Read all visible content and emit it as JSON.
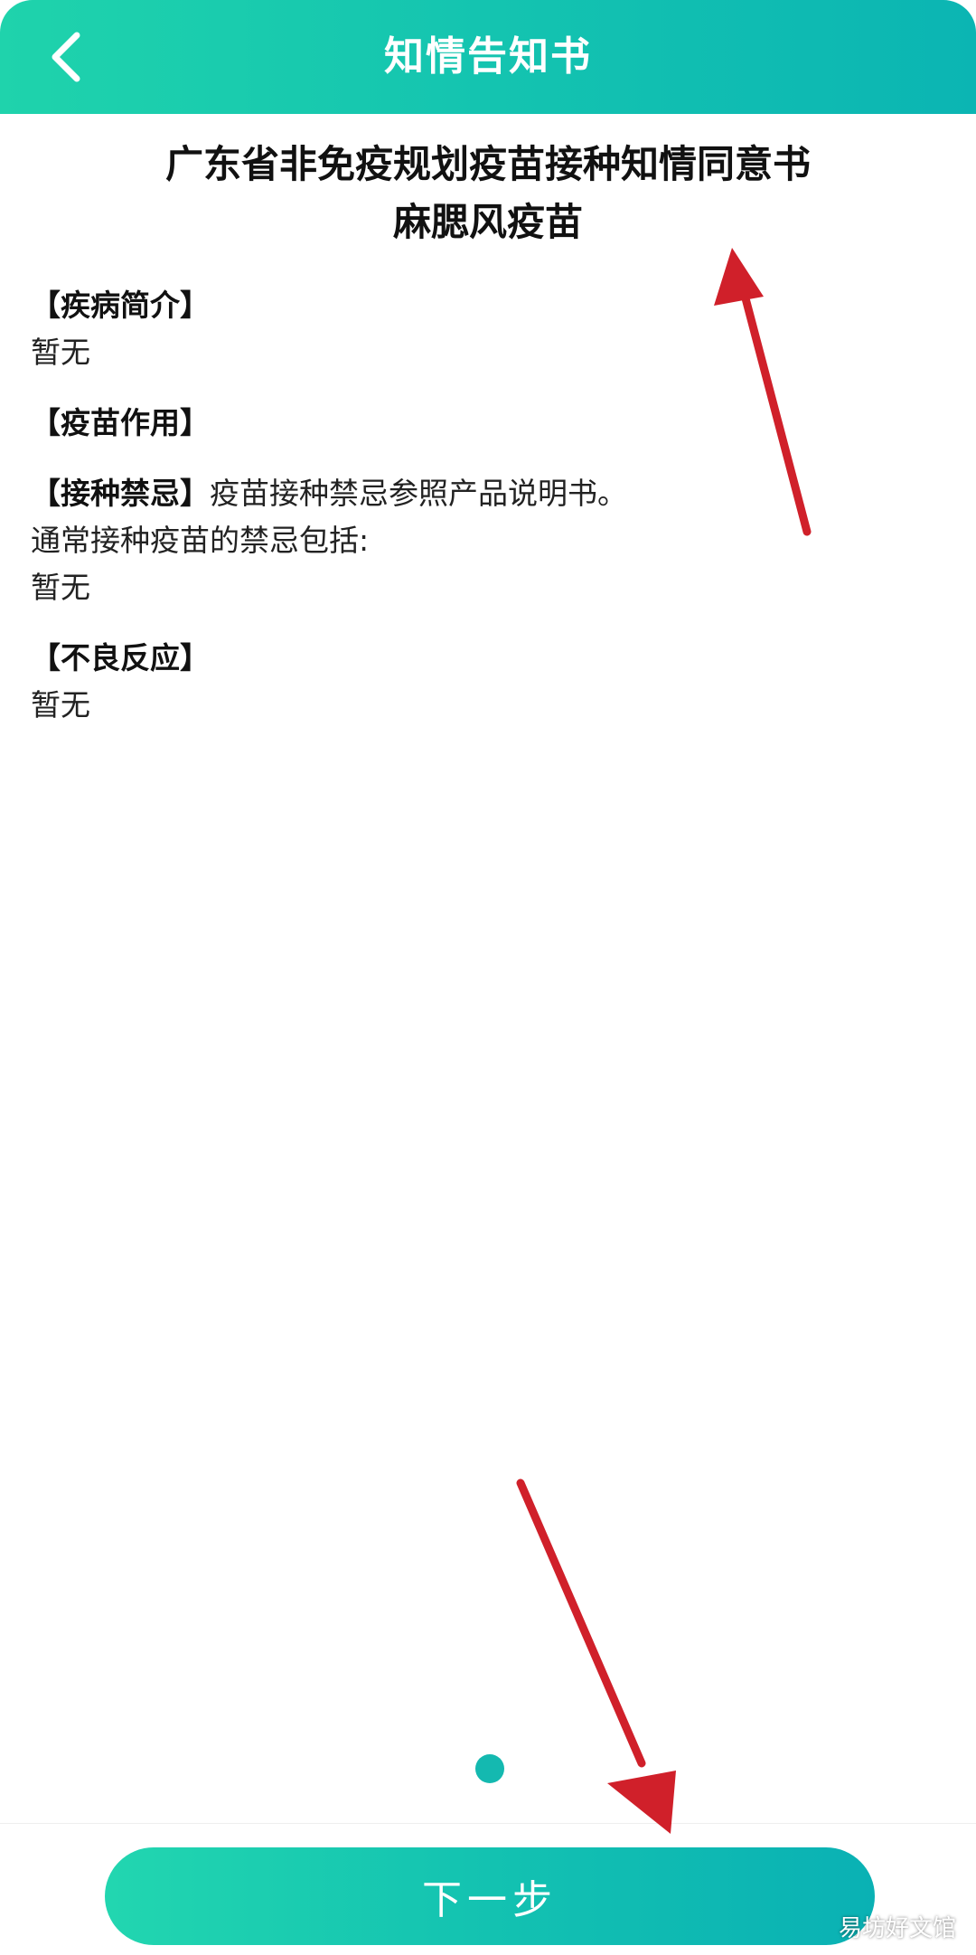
{
  "header": {
    "title": "知情告知书"
  },
  "document": {
    "title_line1": "广东省非免疫规划疫苗接种知情同意书",
    "title_line2": "麻腮风疫苗"
  },
  "sections": {
    "disease_intro": {
      "heading": "【疾病简介】",
      "body": "暂无"
    },
    "vaccine_effect": {
      "heading": "【疫苗作用】"
    },
    "contraindications": {
      "heading": "【接种禁忌】",
      "inline_text": "疫苗接种禁忌参照产品说明书。",
      "line2": "通常接种疫苗的禁忌包括:",
      "line3": "暂无"
    },
    "adverse_reactions": {
      "heading": "【不良反应】",
      "body": "暂无"
    }
  },
  "footer": {
    "next_label": "下一步"
  },
  "watermark": "易坊好文馆",
  "colors": {
    "accent_start": "#1fd3ac",
    "accent_end": "#0bb5b3",
    "arrow": "#d0202a"
  },
  "icons": {
    "back": "chevron-left-icon"
  }
}
